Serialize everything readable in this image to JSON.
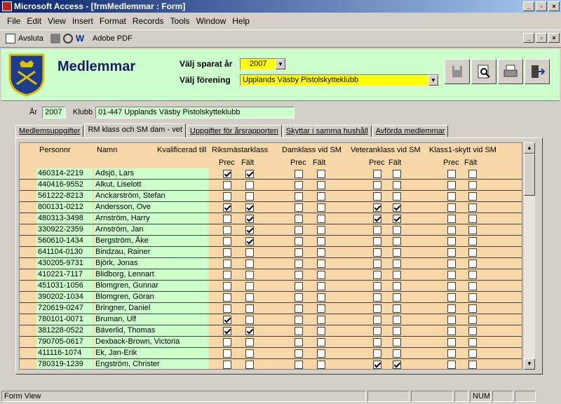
{
  "window": {
    "title": "Microsoft Access - [frmMedlemmar : Form]"
  },
  "menu": [
    "File",
    "Edit",
    "View",
    "Insert",
    "Format",
    "Records",
    "Tools",
    "Window",
    "Help"
  ],
  "toolbar": {
    "close_label": "Avsluta",
    "pdf_label": "Adobe PDF"
  },
  "header": {
    "title": "Medlemmar",
    "year_label": "Välj sparat år",
    "year_value": "2007",
    "club_label": "Välj förening",
    "club_value": "Upplands Väsby Pistolskytteklubb"
  },
  "info": {
    "year_label": "År",
    "year_value": "2007",
    "club_label": "Klubb",
    "club_value": "01-447 Upplands Väsby Pistolskytteklubb"
  },
  "tabs": [
    "Medlemsuppgifter",
    "RM klass och SM dam - vet",
    "Uppgifter för årsrapporten",
    "Skyttar i samma hushåll",
    "Avförda medlemmar"
  ],
  "columns": {
    "personnr": "Personnr",
    "namn": "Namn",
    "kval": "Kvalificerad till",
    "groups": [
      "Riksmästarklass",
      "Damklass vid SM",
      "Veteranklass vid SM",
      "Klass1-skytt vid SM"
    ],
    "prec": "Prec",
    "falt": "Fält"
  },
  "rows": [
    {
      "pnr": "460314-2219",
      "name": "Adsjö, Lars",
      "c": [
        1,
        1,
        0,
        0,
        0,
        0,
        0,
        0
      ]
    },
    {
      "pnr": "440416-9552",
      "name": "Alkut, Liselott",
      "c": [
        0,
        0,
        0,
        0,
        0,
        0,
        0,
        0
      ]
    },
    {
      "pnr": "561222-8213",
      "name": "Anckarström, Stefan",
      "c": [
        0,
        0,
        0,
        0,
        0,
        0,
        0,
        0
      ]
    },
    {
      "pnr": "800131-0212",
      "name": "Andersson, Ove",
      "c": [
        1,
        1,
        0,
        0,
        1,
        1,
        0,
        0
      ]
    },
    {
      "pnr": "480313-3498",
      "name": "Arnström, Harry",
      "c": [
        0,
        1,
        0,
        0,
        1,
        1,
        0,
        0
      ]
    },
    {
      "pnr": "330922-2359",
      "name": "Arnström, Jan",
      "c": [
        0,
        1,
        0,
        0,
        0,
        0,
        0,
        0
      ]
    },
    {
      "pnr": "560610-1434",
      "name": "Bergström, Åke",
      "c": [
        0,
        1,
        0,
        0,
        0,
        0,
        0,
        0
      ]
    },
    {
      "pnr": "641104-0130",
      "name": "Bindzau, Rainer",
      "c": [
        0,
        0,
        0,
        0,
        0,
        0,
        0,
        0
      ]
    },
    {
      "pnr": "430205-9731",
      "name": "Björk, Jonas",
      "c": [
        0,
        0,
        0,
        0,
        0,
        0,
        0,
        0
      ]
    },
    {
      "pnr": "410221-7117",
      "name": "Blidborg, Lennart",
      "c": [
        0,
        0,
        0,
        0,
        0,
        0,
        0,
        0
      ]
    },
    {
      "pnr": "451031-1056",
      "name": "Blomgren, Gunnar",
      "c": [
        0,
        0,
        0,
        0,
        0,
        0,
        0,
        0
      ]
    },
    {
      "pnr": "390202-1034",
      "name": "Blomgren, Göran",
      "c": [
        0,
        0,
        0,
        0,
        0,
        0,
        0,
        0
      ]
    },
    {
      "pnr": "720619-0247",
      "name": "Bringner, Daniel",
      "c": [
        0,
        0,
        0,
        0,
        0,
        0,
        0,
        0
      ]
    },
    {
      "pnr": "780101-0071",
      "name": "Bruman, Ulf",
      "c": [
        1,
        0,
        0,
        0,
        0,
        0,
        0,
        0
      ]
    },
    {
      "pnr": "381228-0522",
      "name": "Bäverlid, Thomas",
      "c": [
        1,
        1,
        0,
        0,
        0,
        0,
        0,
        0
      ]
    },
    {
      "pnr": "790705-0617",
      "name": "Dexback-Brown, Victoria",
      "c": [
        0,
        0,
        0,
        0,
        0,
        0,
        0,
        0
      ]
    },
    {
      "pnr": "411116-1074",
      "name": "Ek, Jan-Erik",
      "c": [
        0,
        0,
        0,
        0,
        0,
        0,
        0,
        0
      ]
    },
    {
      "pnr": "780319-1239",
      "name": "Engström, Christer",
      "c": [
        0,
        0,
        0,
        0,
        1,
        1,
        0,
        0
      ]
    }
  ],
  "status": {
    "mode": "Form View",
    "num": "NUM"
  }
}
